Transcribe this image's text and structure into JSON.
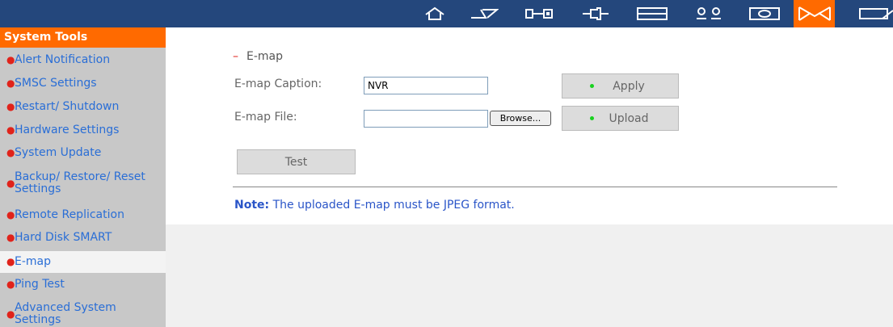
{
  "topbar": {
    "icons": [
      {
        "name": "home-icon"
      },
      {
        "name": "lightning-icon"
      },
      {
        "name": "network-icon"
      },
      {
        "name": "plug-icon"
      },
      {
        "name": "storage-icon"
      },
      {
        "name": "users-icon"
      },
      {
        "name": "monitor-icon"
      },
      {
        "name": "email-icon"
      },
      {
        "name": "folder-icon"
      }
    ],
    "active_icon": "email-icon",
    "accent_color": "#ff6a00",
    "bar_color": "#24477c"
  },
  "sidebar": {
    "title": "System Tools",
    "items": [
      {
        "label": "Alert Notification"
      },
      {
        "label": "SMSC Settings"
      },
      {
        "label": "Restart/ Shutdown"
      },
      {
        "label": "Hardware Settings"
      },
      {
        "label": "System Update"
      },
      {
        "label": "Backup/ Restore/ Reset Settings"
      },
      {
        "label": "Remote Replication"
      },
      {
        "label": "Hard Disk SMART"
      },
      {
        "label": "E-map"
      },
      {
        "label": "Ping Test"
      },
      {
        "label": "Advanced System Settings"
      }
    ],
    "active_item": "E-map"
  },
  "main": {
    "section_title": "E-map",
    "caption_label": "E-map Caption:",
    "caption_value": "NVR",
    "file_label": "E-map File:",
    "file_value": "",
    "browse_label": "Browse...",
    "apply_label": "Apply",
    "upload_label": "Upload",
    "test_label": "Test",
    "note_prefix": "Note:",
    "note_text": "The uploaded E-map must be JPEG format."
  }
}
